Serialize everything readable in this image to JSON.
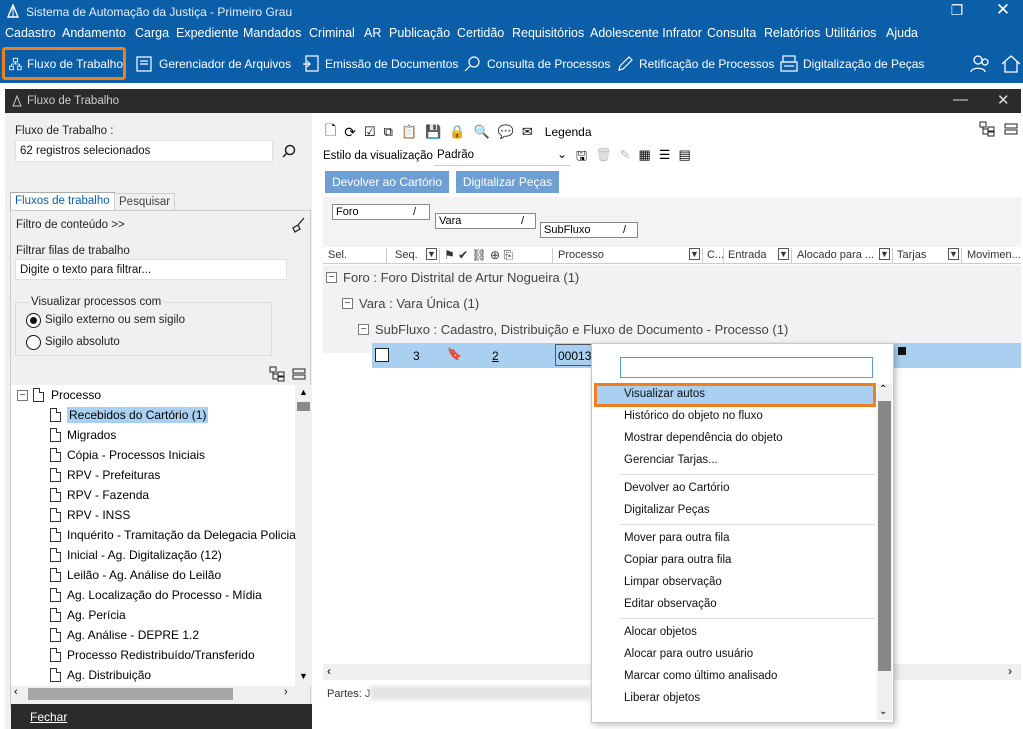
{
  "app": {
    "title": "Sistema de Automação da Justiça - Primeiro Grau"
  },
  "menu": [
    "Cadastro",
    "Andamento",
    "Carga",
    "Expediente",
    "Mandados",
    "Criminal",
    "AR",
    "Publicação",
    "Certidão",
    "Requisitórios",
    "Adolescente Infrator",
    "Consulta",
    "Relatórios",
    "Utilitários",
    "Ajuda"
  ],
  "toolbar": {
    "fluxo": "Fluxo de Trabalho",
    "gerenciador": "Gerenciador de Arquivos",
    "emissao": "Emissão de Documentos",
    "consulta": "Consulta de Processos",
    "retificacao": "Retificação de Processos",
    "digitalizacao": "Digitalização de Peças"
  },
  "window": {
    "title": "Fluxo de Trabalho"
  },
  "left": {
    "fluxo_label": "Fluxo de Trabalho :",
    "fluxo_value": "62 registros selecionados",
    "tab_fluxos": "Fluxos de trabalho",
    "tab_pesquisar": "Pesquisar",
    "filtro_conteudo": "Filtro de conteúdo >>",
    "filtrar_filas": "Filtrar filas de trabalho",
    "filtrar_placeholder": "Digite o texto para filtrar...",
    "visualizar_legend": "Visualizar processos com",
    "radio1": "Sigilo externo ou sem sigilo",
    "radio2": "Sigilo absoluto",
    "tree_root": "Processo",
    "tree_items": [
      "Recebidos do Cartório (1)",
      "Migrados",
      "Cópia - Processos Iniciais",
      "RPV - Prefeituras",
      "RPV - Fazenda",
      "RPV - INSS",
      "Inquérito - Tramitação da Delegacia Policia",
      "Inicial - Ag. Digitalização (12)",
      "Leilão - Ag. Análise do Leilão",
      "Ag. Localização do Processo - Mídia",
      "Ag. Perícia",
      "Ag. Análise - DEPRE 1.2",
      "Processo Redistribuído/Transferido",
      "Ag. Distribuição"
    ],
    "fechar": "Fechar"
  },
  "right": {
    "legenda": "Legenda",
    "estilo_label": "Estilo da visualização",
    "estilo_value": "Padrão",
    "btn_devolver": "Devolver ao Cartório",
    "btn_digitalizar": "Digitalizar Peças",
    "group_foro": "Foro",
    "group_vara": "Vara",
    "group_subfluxo": "SubFluxo",
    "cols": {
      "sel": "Sel.",
      "seq": "Seq.",
      "processo": "Processo",
      "c": "C...",
      "entrada": "Entrada",
      "alocado": "Alocado para ...",
      "tarjas": "Tarjas",
      "movimen": "Movimen..."
    },
    "g1": "Foro : Foro Distrital de Artur Nogueira  (1)",
    "g2": "Vara : Vara Única  (1)",
    "g3": "SubFluxo : Cadastro, Distribuição e Fluxo de Documento - Processo  (1)",
    "row_seq": "3",
    "row_num": "2",
    "row_proc": "00013",
    "partes": "Partes: J"
  },
  "context_menu": [
    "Visualizar autos",
    "Histórico do objeto no fluxo",
    "Mostrar dependência do objeto",
    "Gerenciar Tarjas...",
    "Devolver ao Cartório",
    "Digitalizar Peças",
    "Mover para outra fila",
    "Copiar para outra fila",
    "Limpar observação",
    "Editar observação",
    "Alocar objetos",
    "Alocar para outro usuário",
    "Marcar como último analisado",
    "Liberar objetos"
  ],
  "colors": {
    "brand": "#0b5ea8",
    "highlight": "#f07f1f",
    "selection": "#a9d0f0"
  }
}
